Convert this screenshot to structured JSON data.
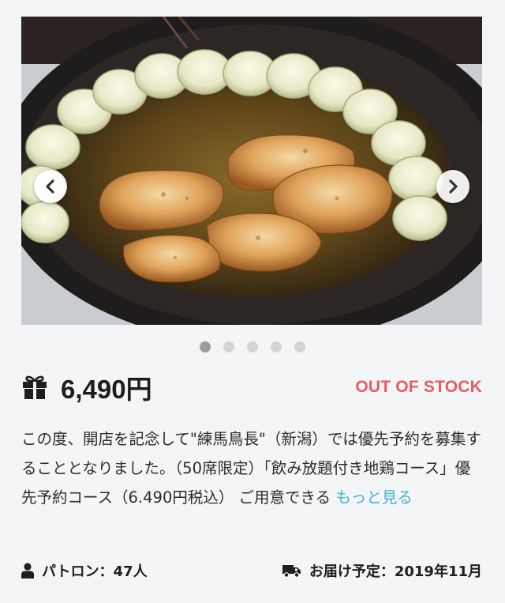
{
  "carousel": {
    "slide_count": 5,
    "active_index": 0,
    "prev_icon": "chevron-left-icon",
    "next_icon": "chevron-right-icon"
  },
  "product": {
    "price_icon": "gift-icon",
    "price": "6,490円",
    "stock_status": "OUT OF STOCK",
    "stock_color": "#e45e61"
  },
  "description": {
    "text": "この度、開店を記念して\"練馬鳥長\"（新潟）では優先予約を募集することとなりました。（50席限定）「飲み放題付き地鶏コース」優先予約コース（6.490円税込） ご用意できる ",
    "more_label": "もっと見る",
    "link_color": "#42b3d5"
  },
  "stats": {
    "patrons_icon": "user-icon",
    "patrons": "パトロン：47人",
    "delivery_icon": "truck-icon",
    "delivery": "お届け予定：2019年11月"
  }
}
